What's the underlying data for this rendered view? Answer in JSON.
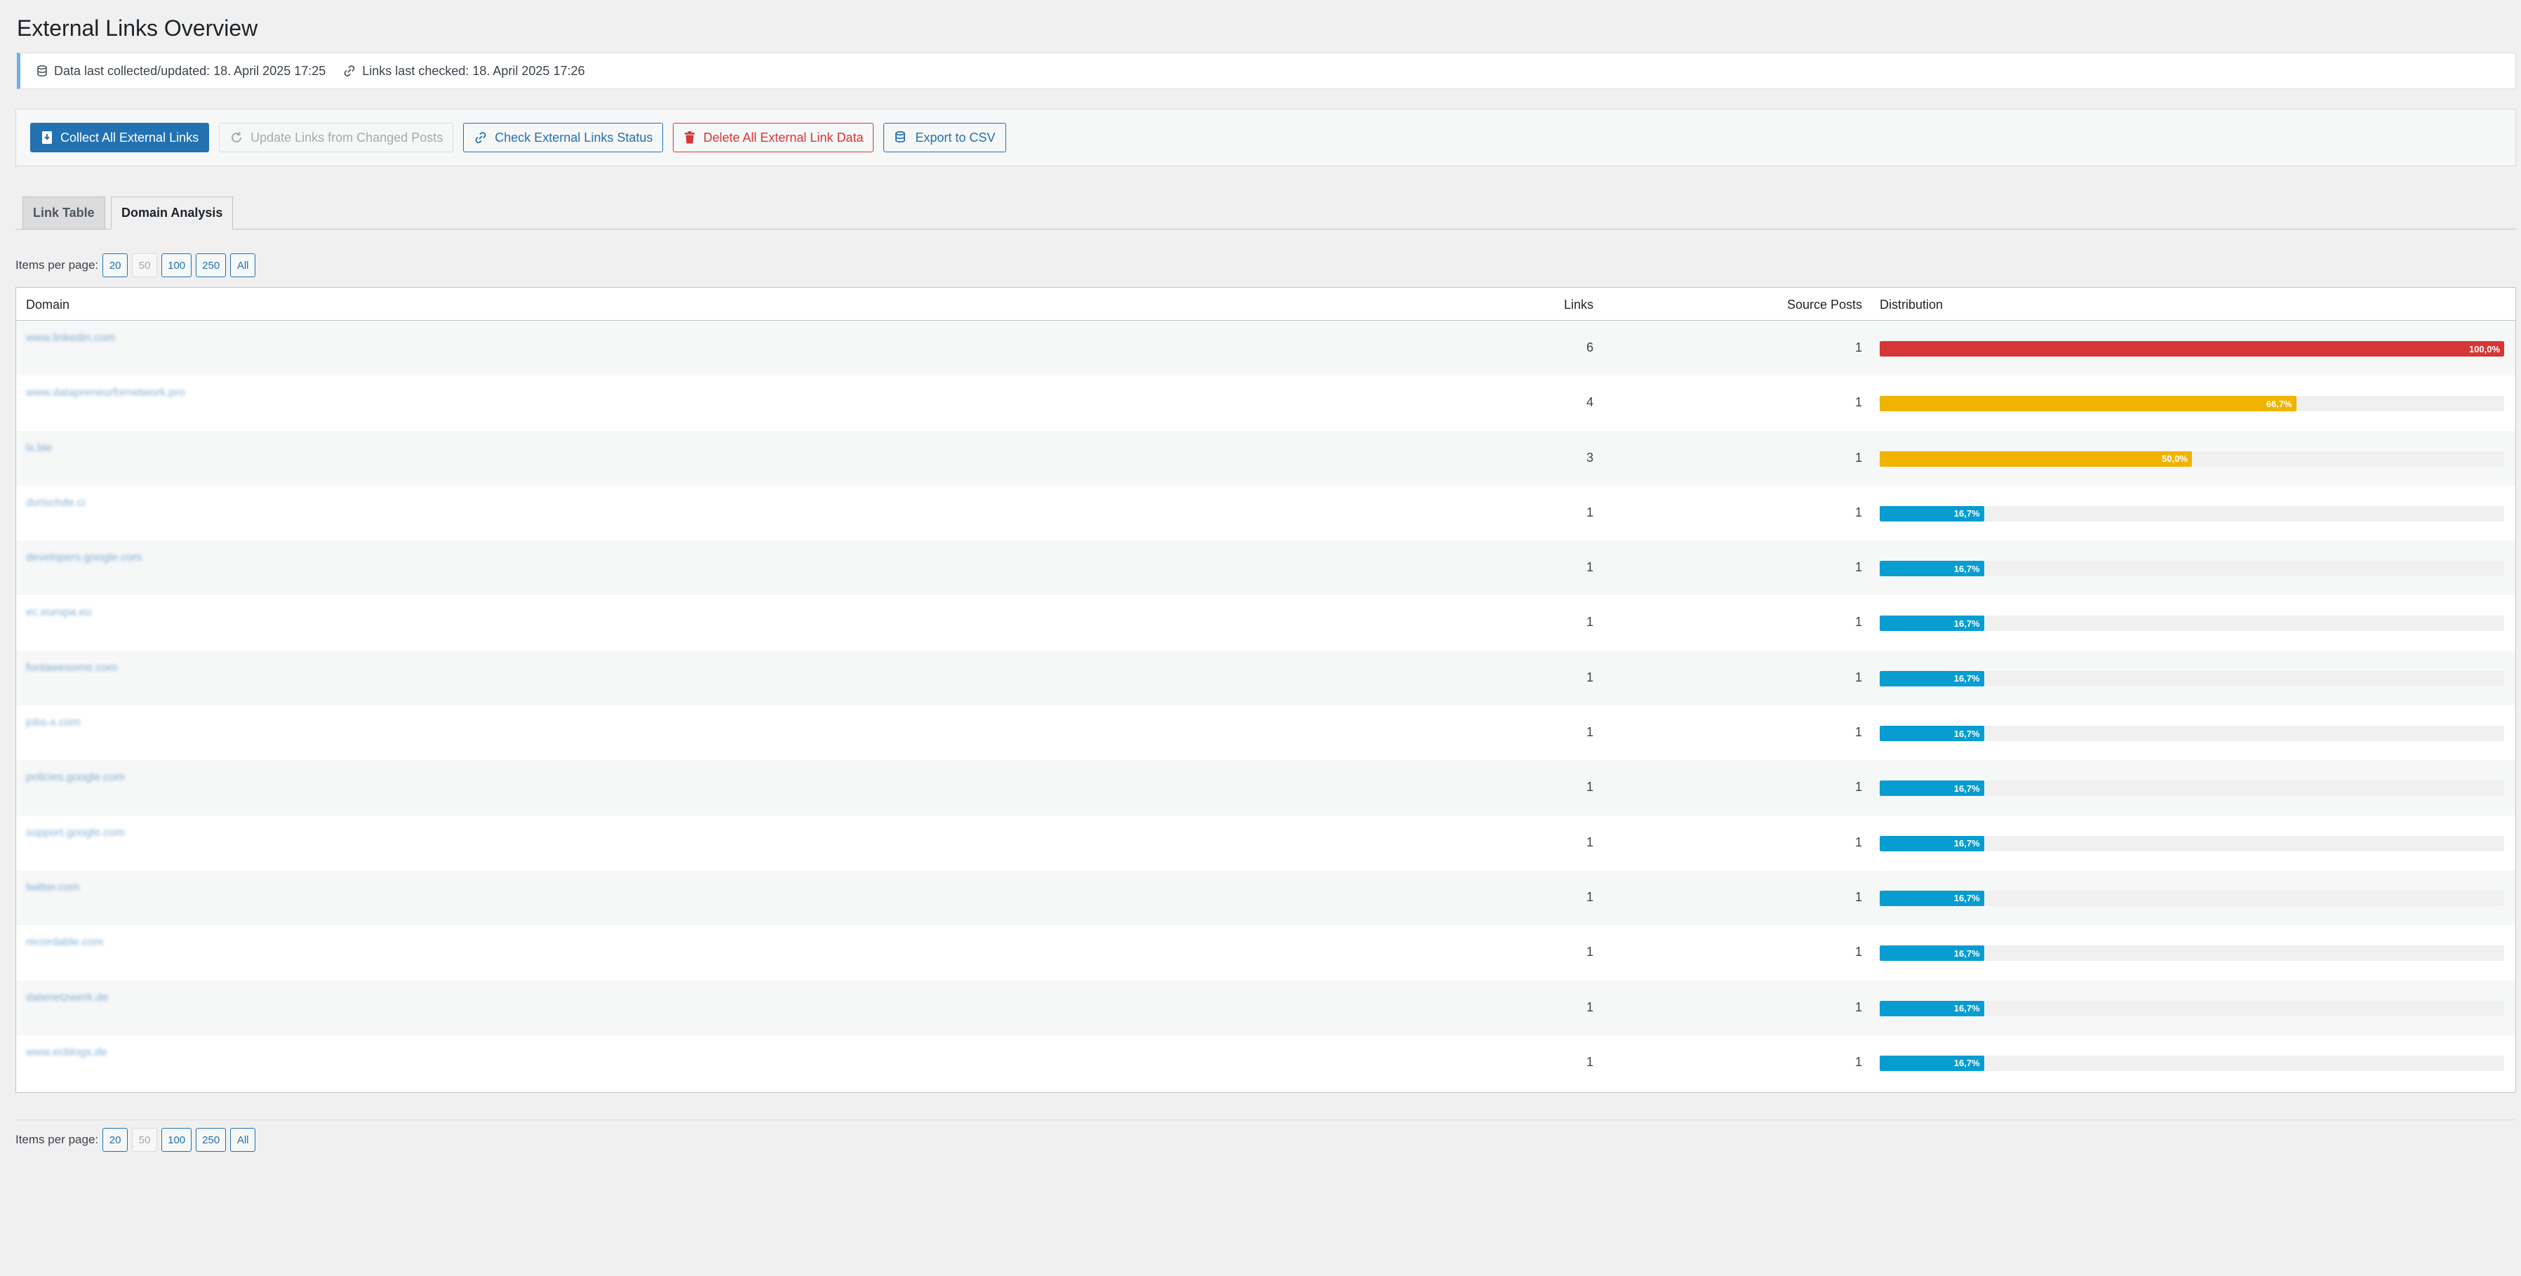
{
  "page": {
    "title": "External Links Overview"
  },
  "notice": {
    "collected": "Data last collected/updated: 18. April 2025 17:25",
    "checked": "Links last checked: 18. April 2025 17:26"
  },
  "toolbar": {
    "collect_label": "Collect All External Links",
    "update_label": "Update Links from Changed Posts",
    "check_label": "Check External Links Status",
    "delete_label": "Delete All External Link Data",
    "export_label": "Export to CSV"
  },
  "tabs": [
    {
      "label": "Link Table",
      "active": false
    },
    {
      "label": "Domain Analysis",
      "active": true
    }
  ],
  "pagination": {
    "label": "Items per page:",
    "options": [
      "20",
      "50",
      "100",
      "250",
      "All"
    ],
    "current": "50"
  },
  "table": {
    "headers": {
      "domain": "Domain",
      "links": "Links",
      "posts": "Source Posts",
      "distribution": "Distribution"
    },
    "rows": [
      {
        "domain": "www.linkedin.com",
        "links": "6",
        "posts": "1",
        "pct": 100,
        "label": "100,0%",
        "color": "#d63638"
      },
      {
        "domain": "www.datapreneurfornetwork.pro",
        "links": "4",
        "posts": "1",
        "pct": 66.7,
        "label": "66,7%",
        "color": "#f0b400"
      },
      {
        "domain": "lx.ble",
        "links": "3",
        "posts": "1",
        "pct": 50,
        "label": "50,0%",
        "color": "#f0b400"
      },
      {
        "domain": "dvrischde.ci",
        "links": "1",
        "posts": "1",
        "pct": 16.7,
        "label": "16,7%",
        "color": "#079dd0"
      },
      {
        "domain": "developers.google.com",
        "links": "1",
        "posts": "1",
        "pct": 16.7,
        "label": "16,7%",
        "color": "#079dd0"
      },
      {
        "domain": "ec.europa.eu",
        "links": "1",
        "posts": "1",
        "pct": 16.7,
        "label": "16,7%",
        "color": "#079dd0"
      },
      {
        "domain": "fontawesome.com",
        "links": "1",
        "posts": "1",
        "pct": 16.7,
        "label": "16,7%",
        "color": "#079dd0"
      },
      {
        "domain": "jobs-x.com",
        "links": "1",
        "posts": "1",
        "pct": 16.7,
        "label": "16,7%",
        "color": "#079dd0"
      },
      {
        "domain": "policies.google.com",
        "links": "1",
        "posts": "1",
        "pct": 16.7,
        "label": "16,7%",
        "color": "#079dd0"
      },
      {
        "domain": "support.google.com",
        "links": "1",
        "posts": "1",
        "pct": 16.7,
        "label": "16,7%",
        "color": "#079dd0"
      },
      {
        "domain": "twitter.com",
        "links": "1",
        "posts": "1",
        "pct": 16.7,
        "label": "16,7%",
        "color": "#079dd0"
      },
      {
        "domain": "recordable.com",
        "links": "1",
        "posts": "1",
        "pct": 16.7,
        "label": "16,7%",
        "color": "#079dd0"
      },
      {
        "domain": "datenetzwerk.de",
        "links": "1",
        "posts": "1",
        "pct": 16.7,
        "label": "16,7%",
        "color": "#079dd0"
      },
      {
        "domain": "www.ecblogs.de",
        "links": "1",
        "posts": "1",
        "pct": 16.7,
        "label": "16,7%",
        "color": "#079dd0"
      }
    ]
  }
}
